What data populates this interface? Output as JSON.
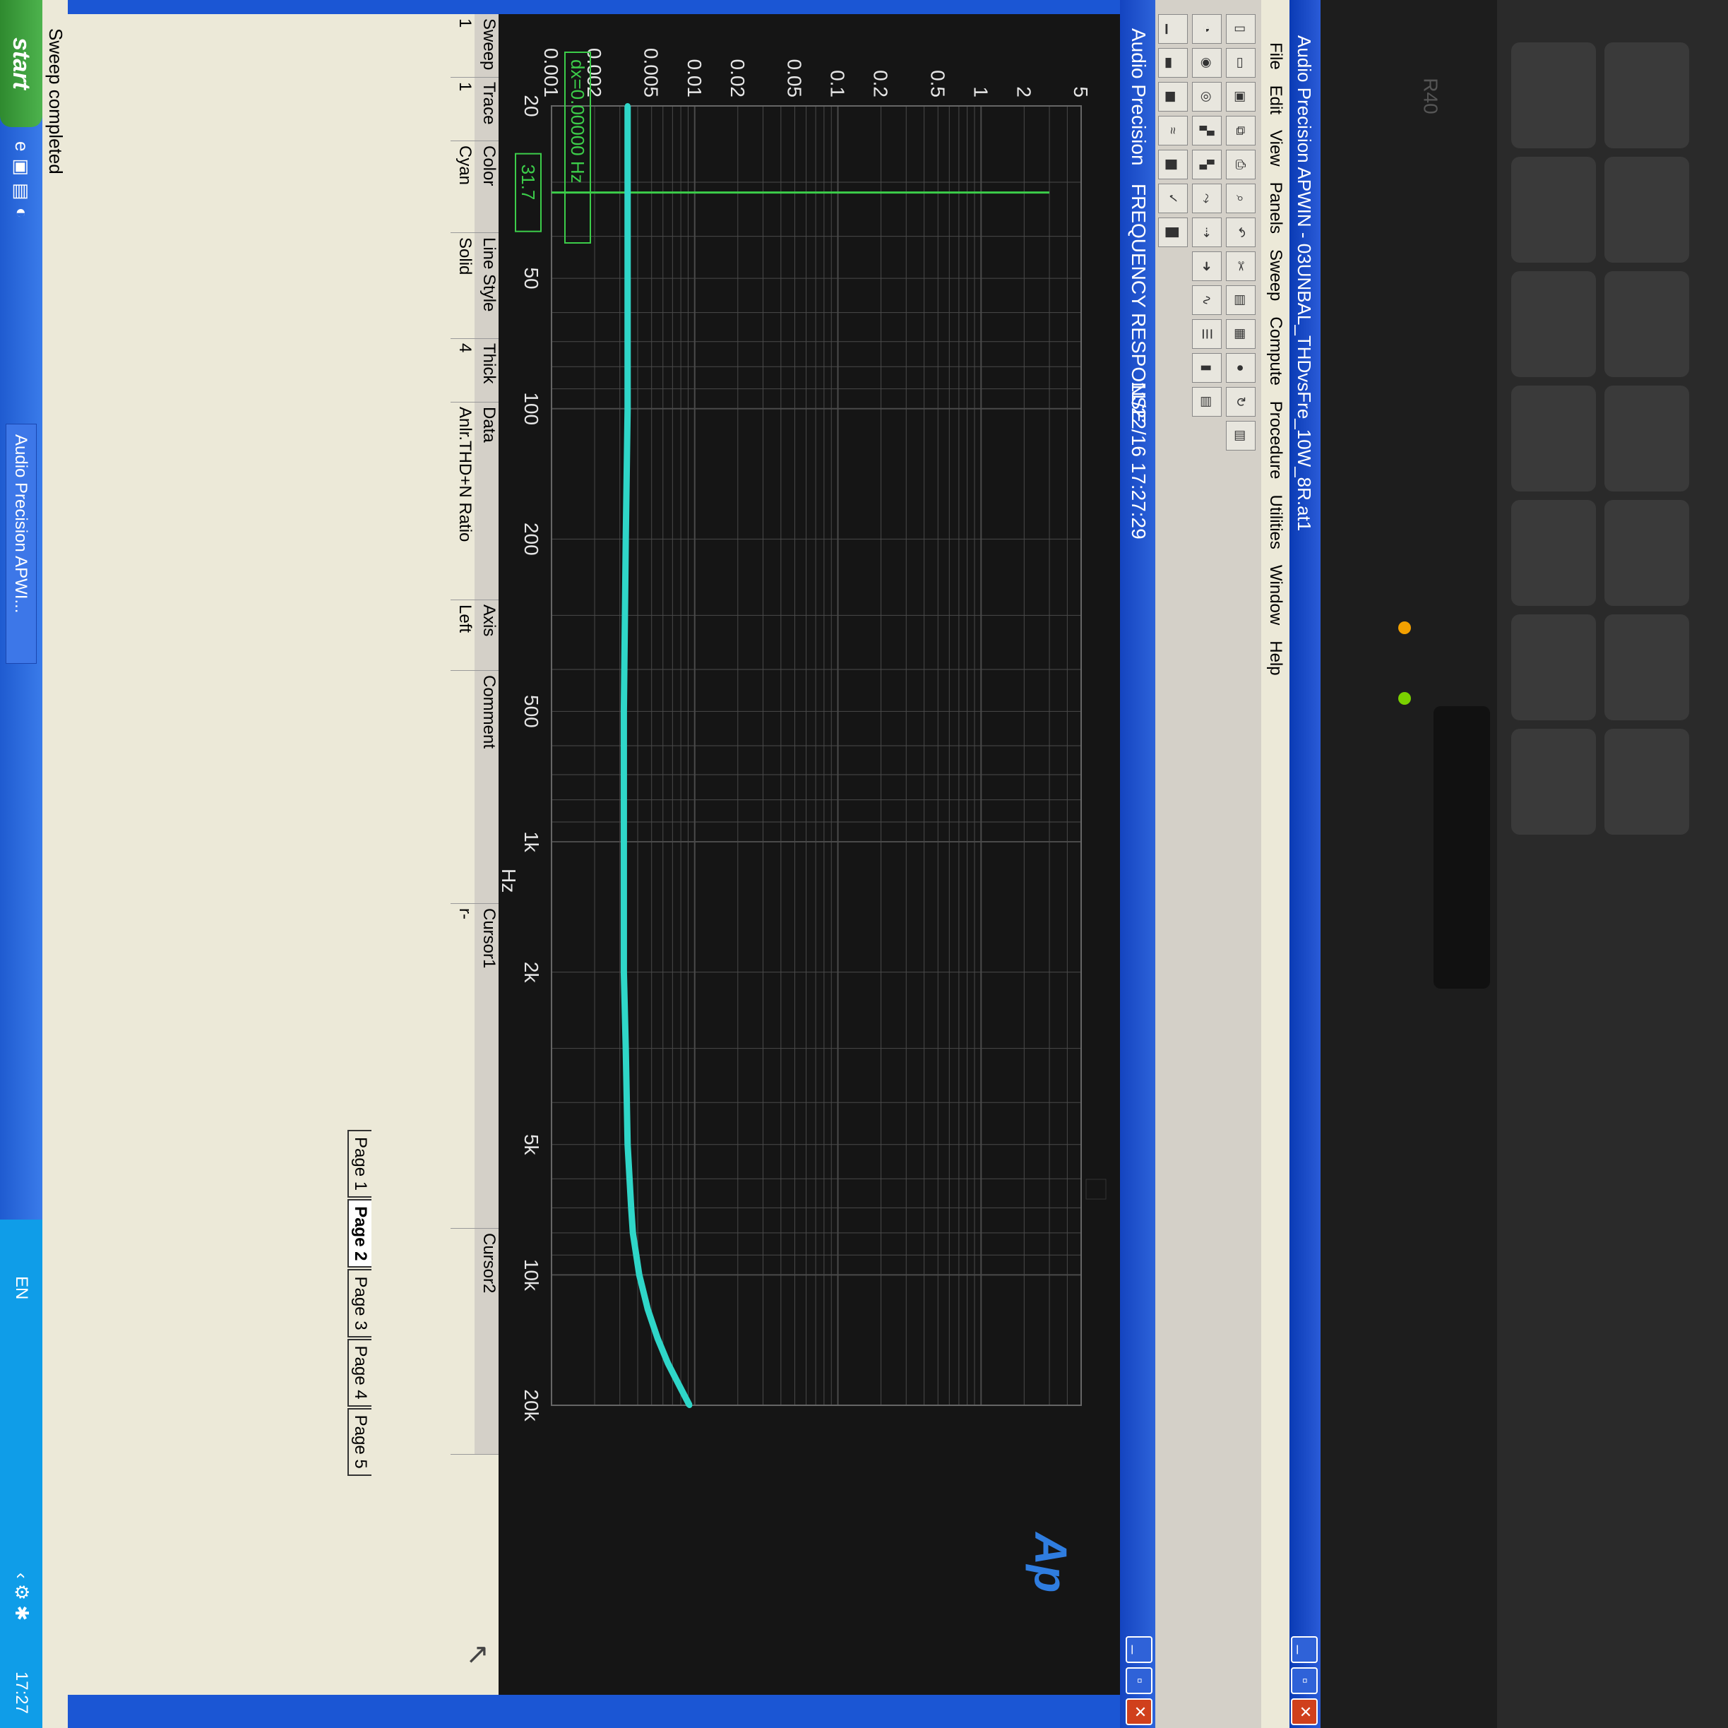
{
  "app": {
    "title": "Audio Precision APWIN - 03UNBAL_THDvsFre_10W_8R.at1",
    "menu": [
      "File",
      "Edit",
      "View",
      "Panels",
      "Sweep",
      "Compute",
      "Procedure",
      "Utilities",
      "Window",
      "Help"
    ]
  },
  "graph_window": {
    "title_brand": "Audio Precision",
    "title_name": "FREQUENCY RESPONSE",
    "timestamp": "11/22/16 17:27:29",
    "logo": "Ap",
    "cursor_readout": "dx=0.00000 Hz",
    "cursor_value": "31.7"
  },
  "chart_data": {
    "type": "line",
    "xscale": "log",
    "yscale": "log",
    "xlabel": "Hz",
    "ylabel": "%",
    "xlim": [
      20,
      20000
    ],
    "ylim": [
      0.001,
      5
    ],
    "x_ticks": [
      "20",
      "50",
      "100",
      "200",
      "500",
      "1k",
      "2k",
      "5k",
      "10k",
      "20k"
    ],
    "x_tick_values": [
      20,
      50,
      100,
      200,
      500,
      1000,
      2000,
      5000,
      10000,
      20000
    ],
    "y_ticks": [
      "5",
      "2",
      "1",
      "0.5",
      "0.2",
      "0.1",
      "0.05",
      "0.02",
      "0.01",
      "0.005",
      "0.002",
      "0.001"
    ],
    "y_tick_values": [
      5,
      2,
      1,
      0.5,
      0.2,
      0.1,
      0.05,
      0.02,
      0.01,
      0.005,
      0.002,
      0.001
    ],
    "grid": true,
    "series": [
      {
        "color": "#2fd6c8",
        "x": [
          20,
          31.7,
          50,
          100,
          200,
          500,
          1000,
          2000,
          3000,
          5000,
          7000,
          8000,
          10000,
          12000,
          14000,
          16000,
          18000,
          20000
        ],
        "y": [
          0.0034,
          0.0034,
          0.0034,
          0.0034,
          0.0033,
          0.0032,
          0.0032,
          0.0032,
          0.0033,
          0.0034,
          0.0036,
          0.0037,
          0.0041,
          0.0047,
          0.0055,
          0.0065,
          0.0078,
          0.0092
        ]
      }
    ],
    "cursor_x": 31.7
  },
  "trace_panel": {
    "headers": [
      "Sweep",
      "Trace",
      "Color",
      "Line Style",
      "Thick",
      "Data",
      "Axis",
      "Comment",
      "Cursor1",
      "Cursor2"
    ],
    "rows": [
      {
        "sweep": "1",
        "trace": "1",
        "color": "Cyan",
        "line_style": "Solid",
        "thick": "4",
        "data": "Anlr.THD+N Ratio",
        "axis": "Left",
        "comment": "",
        "cursor1": "r-",
        "cursor2": ""
      }
    ],
    "pages": [
      "Page 1",
      "Page 2",
      "Page 3",
      "Page 4",
      "Page 5"
    ],
    "active_page": "Page 2"
  },
  "status": {
    "text": "Sweep completed"
  },
  "taskbar": {
    "start": "start",
    "task": "Audio Precision APWI...",
    "lang": "EN",
    "clock": "17:27"
  },
  "bezel": {
    "model": "R40"
  }
}
